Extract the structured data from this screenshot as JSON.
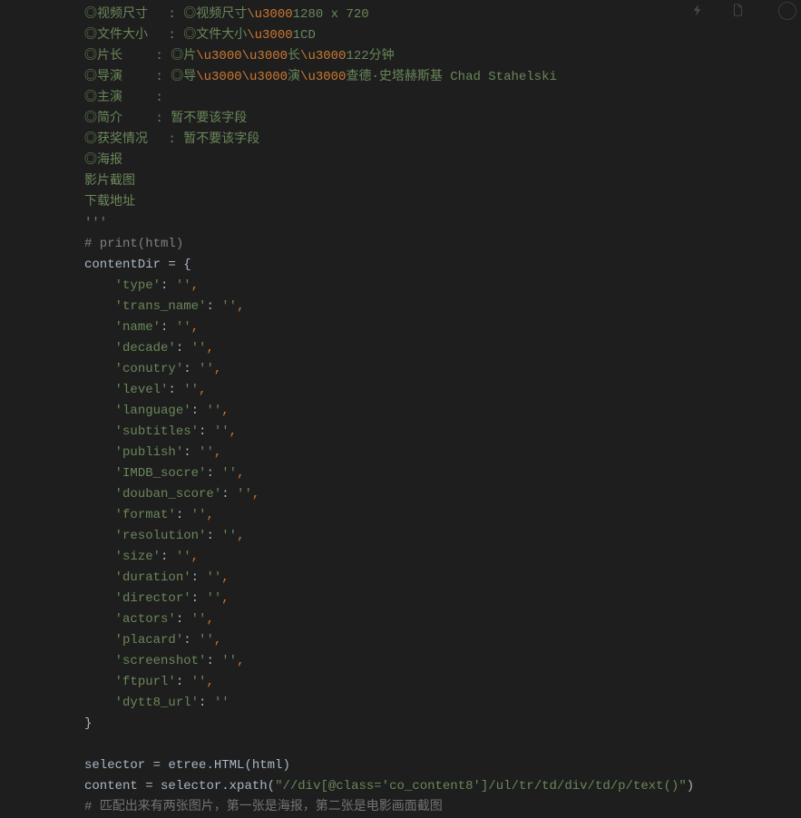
{
  "lines": [
    {
      "type": "str",
      "segments": [
        {
          "t": "◎视频尺寸　 : ◎视频尺寸",
          "c": "str"
        },
        {
          "t": "\\u3000",
          "c": "unicode"
        },
        {
          "t": "1280 x 720",
          "c": "str"
        }
      ]
    },
    {
      "type": "str",
      "segments": [
        {
          "t": "◎文件大小　 : ◎文件大小",
          "c": "str"
        },
        {
          "t": "\\u3000",
          "c": "unicode"
        },
        {
          "t": "1CD",
          "c": "str"
        }
      ]
    },
    {
      "type": "str",
      "segments": [
        {
          "t": "◎片长　　 : ◎片",
          "c": "str"
        },
        {
          "t": "\\u3000\\u3000",
          "c": "unicode"
        },
        {
          "t": "长",
          "c": "str"
        },
        {
          "t": "\\u3000",
          "c": "unicode"
        },
        {
          "t": "122分钟",
          "c": "str"
        }
      ]
    },
    {
      "type": "str",
      "segments": [
        {
          "t": "◎导演　　 : ◎导",
          "c": "str"
        },
        {
          "t": "\\u3000\\u3000",
          "c": "unicode"
        },
        {
          "t": "演",
          "c": "str"
        },
        {
          "t": "\\u3000",
          "c": "unicode"
        },
        {
          "t": "查德·史塔赫斯基 Chad Stahelski",
          "c": "str"
        }
      ]
    },
    {
      "type": "str",
      "segments": [
        {
          "t": "◎主演　　 :",
          "c": "str"
        }
      ]
    },
    {
      "type": "str",
      "segments": [
        {
          "t": "◎简介　　 : 暂不要该字段",
          "c": "str"
        }
      ]
    },
    {
      "type": "str",
      "segments": [
        {
          "t": "◎获奖情况　 : 暂不要该字段",
          "c": "str"
        }
      ]
    },
    {
      "type": "str",
      "segments": [
        {
          "t": "◎海报",
          "c": "str"
        }
      ]
    },
    {
      "type": "str",
      "segments": [
        {
          "t": "影片截图",
          "c": "str"
        }
      ]
    },
    {
      "type": "str",
      "segments": [
        {
          "t": "下载地址",
          "c": "str"
        }
      ]
    },
    {
      "type": "str",
      "segments": [
        {
          "t": "'''",
          "c": "str"
        }
      ]
    },
    {
      "type": "comment",
      "segments": [
        {
          "t": "# print(html)",
          "c": "comment"
        }
      ]
    },
    {
      "type": "code",
      "segments": [
        {
          "t": "contentDir ",
          "c": "plain"
        },
        {
          "t": "= ",
          "c": "plain"
        },
        {
          "t": "{",
          "c": "plain"
        }
      ]
    },
    {
      "type": "code",
      "segments": [
        {
          "t": "    ",
          "c": "plain"
        },
        {
          "t": "'type'",
          "c": "key"
        },
        {
          "t": ": ",
          "c": "plain"
        },
        {
          "t": "''",
          "c": "key"
        },
        {
          "t": ",",
          "c": "punct"
        }
      ]
    },
    {
      "type": "code",
      "segments": [
        {
          "t": "    ",
          "c": "plain"
        },
        {
          "t": "'trans_name'",
          "c": "key"
        },
        {
          "t": ": ",
          "c": "plain"
        },
        {
          "t": "''",
          "c": "key"
        },
        {
          "t": ",",
          "c": "punct"
        }
      ]
    },
    {
      "type": "code",
      "segments": [
        {
          "t": "    ",
          "c": "plain"
        },
        {
          "t": "'name'",
          "c": "key"
        },
        {
          "t": ": ",
          "c": "plain"
        },
        {
          "t": "''",
          "c": "key"
        },
        {
          "t": ",",
          "c": "punct"
        }
      ]
    },
    {
      "type": "code",
      "segments": [
        {
          "t": "    ",
          "c": "plain"
        },
        {
          "t": "'decade'",
          "c": "key"
        },
        {
          "t": ": ",
          "c": "plain"
        },
        {
          "t": "''",
          "c": "key"
        },
        {
          "t": ",",
          "c": "punct"
        }
      ]
    },
    {
      "type": "code",
      "segments": [
        {
          "t": "    ",
          "c": "plain"
        },
        {
          "t": "'conutry'",
          "c": "key"
        },
        {
          "t": ": ",
          "c": "plain"
        },
        {
          "t": "''",
          "c": "key"
        },
        {
          "t": ",",
          "c": "punct"
        }
      ]
    },
    {
      "type": "code",
      "segments": [
        {
          "t": "    ",
          "c": "plain"
        },
        {
          "t": "'level'",
          "c": "key"
        },
        {
          "t": ": ",
          "c": "plain"
        },
        {
          "t": "''",
          "c": "key"
        },
        {
          "t": ",",
          "c": "punct"
        }
      ]
    },
    {
      "type": "code",
      "segments": [
        {
          "t": "    ",
          "c": "plain"
        },
        {
          "t": "'language'",
          "c": "key"
        },
        {
          "t": ": ",
          "c": "plain"
        },
        {
          "t": "''",
          "c": "key"
        },
        {
          "t": ",",
          "c": "punct"
        }
      ]
    },
    {
      "type": "code",
      "segments": [
        {
          "t": "    ",
          "c": "plain"
        },
        {
          "t": "'subtitles'",
          "c": "key"
        },
        {
          "t": ": ",
          "c": "plain"
        },
        {
          "t": "''",
          "c": "key"
        },
        {
          "t": ",",
          "c": "punct"
        }
      ]
    },
    {
      "type": "code",
      "segments": [
        {
          "t": "    ",
          "c": "plain"
        },
        {
          "t": "'publish'",
          "c": "key"
        },
        {
          "t": ": ",
          "c": "plain"
        },
        {
          "t": "''",
          "c": "key"
        },
        {
          "t": ",",
          "c": "punct"
        }
      ]
    },
    {
      "type": "code",
      "segments": [
        {
          "t": "    ",
          "c": "plain"
        },
        {
          "t": "'IMDB_socre'",
          "c": "key"
        },
        {
          "t": ": ",
          "c": "plain"
        },
        {
          "t": "''",
          "c": "key"
        },
        {
          "t": ",",
          "c": "punct"
        }
      ]
    },
    {
      "type": "code",
      "segments": [
        {
          "t": "    ",
          "c": "plain"
        },
        {
          "t": "'douban_score'",
          "c": "key"
        },
        {
          "t": ": ",
          "c": "plain"
        },
        {
          "t": "''",
          "c": "key"
        },
        {
          "t": ",",
          "c": "punct"
        }
      ]
    },
    {
      "type": "code",
      "segments": [
        {
          "t": "    ",
          "c": "plain"
        },
        {
          "t": "'format'",
          "c": "key"
        },
        {
          "t": ": ",
          "c": "plain"
        },
        {
          "t": "''",
          "c": "key"
        },
        {
          "t": ",",
          "c": "punct"
        }
      ]
    },
    {
      "type": "code",
      "segments": [
        {
          "t": "    ",
          "c": "plain"
        },
        {
          "t": "'resolution'",
          "c": "key"
        },
        {
          "t": ": ",
          "c": "plain"
        },
        {
          "t": "''",
          "c": "key"
        },
        {
          "t": ",",
          "c": "punct"
        }
      ]
    },
    {
      "type": "code",
      "segments": [
        {
          "t": "    ",
          "c": "plain"
        },
        {
          "t": "'size'",
          "c": "key"
        },
        {
          "t": ": ",
          "c": "plain"
        },
        {
          "t": "''",
          "c": "key"
        },
        {
          "t": ",",
          "c": "punct"
        }
      ]
    },
    {
      "type": "code",
      "segments": [
        {
          "t": "    ",
          "c": "plain"
        },
        {
          "t": "'duration'",
          "c": "key"
        },
        {
          "t": ": ",
          "c": "plain"
        },
        {
          "t": "''",
          "c": "key"
        },
        {
          "t": ",",
          "c": "punct"
        }
      ]
    },
    {
      "type": "code",
      "segments": [
        {
          "t": "    ",
          "c": "plain"
        },
        {
          "t": "'director'",
          "c": "key"
        },
        {
          "t": ": ",
          "c": "plain"
        },
        {
          "t": "''",
          "c": "key"
        },
        {
          "t": ",",
          "c": "punct"
        }
      ]
    },
    {
      "type": "code",
      "segments": [
        {
          "t": "    ",
          "c": "plain"
        },
        {
          "t": "'actors'",
          "c": "key"
        },
        {
          "t": ": ",
          "c": "plain"
        },
        {
          "t": "''",
          "c": "key"
        },
        {
          "t": ",",
          "c": "punct"
        }
      ]
    },
    {
      "type": "code",
      "segments": [
        {
          "t": "    ",
          "c": "plain"
        },
        {
          "t": "'placard'",
          "c": "key"
        },
        {
          "t": ": ",
          "c": "plain"
        },
        {
          "t": "''",
          "c": "key"
        },
        {
          "t": ",",
          "c": "punct"
        }
      ]
    },
    {
      "type": "code",
      "segments": [
        {
          "t": "    ",
          "c": "plain"
        },
        {
          "t": "'screenshot'",
          "c": "key"
        },
        {
          "t": ": ",
          "c": "plain"
        },
        {
          "t": "''",
          "c": "key"
        },
        {
          "t": ",",
          "c": "punct"
        }
      ]
    },
    {
      "type": "code",
      "segments": [
        {
          "t": "    ",
          "c": "plain"
        },
        {
          "t": "'ftpurl'",
          "c": "key"
        },
        {
          "t": ": ",
          "c": "plain"
        },
        {
          "t": "''",
          "c": "key"
        },
        {
          "t": ",",
          "c": "punct"
        }
      ]
    },
    {
      "type": "code",
      "segments": [
        {
          "t": "    ",
          "c": "plain"
        },
        {
          "t": "'dytt8_url'",
          "c": "key"
        },
        {
          "t": ": ",
          "c": "plain"
        },
        {
          "t": "''",
          "c": "key"
        }
      ]
    },
    {
      "type": "code",
      "segments": [
        {
          "t": "}",
          "c": "plain"
        }
      ]
    },
    {
      "type": "blank",
      "segments": []
    },
    {
      "type": "code",
      "segments": [
        {
          "t": "selector ",
          "c": "plain"
        },
        {
          "t": "= ",
          "c": "plain"
        },
        {
          "t": "etree.HTML(html)",
          "c": "plain"
        }
      ]
    },
    {
      "type": "code",
      "segments": [
        {
          "t": "content ",
          "c": "plain"
        },
        {
          "t": "= ",
          "c": "plain"
        },
        {
          "t": "selector.xpath(",
          "c": "plain"
        },
        {
          "t": "\"//div[@class='co_content8']/ul/tr/td/div/td/p/text()\"",
          "c": "str2"
        },
        {
          "t": ")",
          "c": "plain"
        }
      ]
    },
    {
      "type": "comment",
      "segments": [
        {
          "t": "# 匹配出来有两张图片，第一张是海报，第二张是电影画面截图",
          "c": "comment-chinese"
        }
      ]
    }
  ],
  "icons": {
    "lightning": "⚡",
    "document": "🗎"
  }
}
